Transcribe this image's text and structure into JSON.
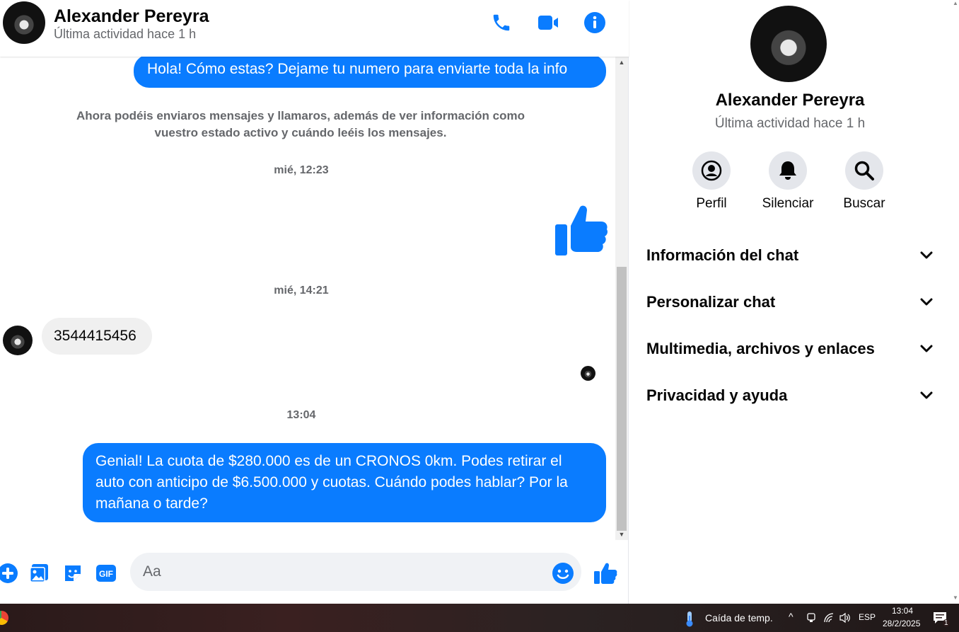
{
  "header": {
    "name": "Alexander Pereyra",
    "status": "Última actividad hace 1 h",
    "icons": [
      "phone-icon",
      "video-icon",
      "info-icon"
    ]
  },
  "messages": {
    "out_first": "Hola! Cómo estas? Dejame tu numero para enviarte toda la info",
    "system_note": "Ahora podéis enviaros mensajes y llamaros, además de ver información como vuestro estado activo y cuándo leéis los mensajes.",
    "ts1": "mié, 12:23",
    "ts2": "mié, 14:21",
    "in_number": "3544415456",
    "ts3": "13:04",
    "out_last": "Genial! La cuota de $280.000 es de un CRONOS 0km. Podes retirar el auto con anticipo de $6.500.000 y cuotas. Cuándo podes hablar? Por la mañana o tarde?"
  },
  "composer": {
    "placeholder": "Aa",
    "icons": [
      "plus-icon",
      "image-icon",
      "sticker-icon",
      "gif-icon",
      "emoji-icon",
      "like-icon"
    ]
  },
  "info_panel": {
    "name": "Alexander Pereyra",
    "status": "Última actividad hace 1 h",
    "actions": [
      {
        "label": "Perfil",
        "icon": "profile-icon"
      },
      {
        "label": "Silenciar",
        "icon": "bell-icon"
      },
      {
        "label": "Buscar",
        "icon": "search-icon"
      }
    ],
    "sections": [
      "Información del chat",
      "Personalizar chat",
      "Multimedia, archivos y enlaces",
      "Privacidad y ayuda"
    ]
  },
  "taskbar": {
    "weather": "Caída de temp.",
    "language": "ESP",
    "time": "13:04",
    "date": "28/2/2025",
    "notification_count": "1"
  },
  "colors": {
    "accent": "#0a7cff",
    "bubble_in": "#f0f0f0",
    "secondary_text": "#65676b"
  }
}
